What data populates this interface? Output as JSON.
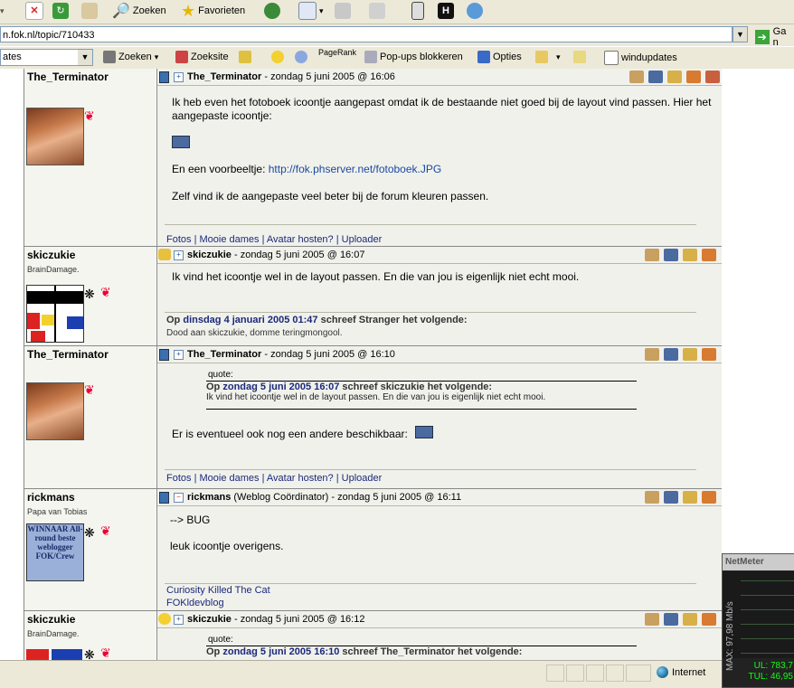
{
  "toolbar": {
    "search_label": "Zoeken",
    "favorites_label": "Favorieten"
  },
  "address": {
    "url": "n.fok.nl/topic/710433",
    "go_label": "Ga n"
  },
  "google_bar": {
    "dropdown_value": "ates",
    "search_label": "Zoeken",
    "site_label": "Zoeksite",
    "pagerank_label": "PageRank",
    "popups_label": "Pop-ups blokkeren",
    "options_label": "Opties",
    "windupdates_label": "windupdates"
  },
  "posts": [
    {
      "username": "The_Terminator",
      "header_user": "The_Terminator",
      "header_date": " - zondag 5 juni 2005 @ 16:06",
      "text1": "Ik heb even het fotoboek icoontje aangepast omdat ik de bestaande niet goed bij de layout vind passen. Hier het aangepaste icoontje:",
      "text2_prefix": "En een voorbeeltje: ",
      "text2_link": "http://fok.phserver.net/fotoboek.JPG",
      "text3": "Zelf vind ik de aangepaste veel beter bij de forum kleuren passen.",
      "signature": "Fotos | Mooie dames | Avatar hosten? | Uploader"
    },
    {
      "username": "skiczukie",
      "user_title": "BrainDamage.",
      "header_user": "skiczukie",
      "header_date": " - zondag 5 juni 2005 @ 16:07",
      "text1": "Ik vind het icoontje wel in de layout passen. En die van jou is eigenlijk niet echt mooi.",
      "sig_quote_prefix": "Op ",
      "sig_quote_date": "dinsdag 4 januari 2005 01:47",
      "sig_quote_suffix": " schreef Stranger het volgende:",
      "sig_quote_text": "Dood aan skiczukie, domme teringmongool."
    },
    {
      "username": "The_Terminator",
      "header_user": "The_Terminator",
      "header_date": " - zondag 5 juni 2005 @ 16:10",
      "quote_caption": "quote:",
      "quote_prefix": "Op ",
      "quote_date": "zondag 5 juni 2005 16:07",
      "quote_suffix": " schreef skiczukie het volgende:",
      "quote_text": "Ik vind het icoontje wel in de layout passen. En die van jou is eigenlijk niet echt mooi.",
      "text1": "Er is eventueel ook nog een andere beschikbaar:",
      "signature": "Fotos | Mooie dames | Avatar hosten? | Uploader"
    },
    {
      "username": "rickmans",
      "user_title": "Papa van Tobias",
      "avatar_text": "WINNAAR All-round beste weblogger FOK/Crew",
      "header_user": "rickmans",
      "header_role": " (Weblog Coördinator)",
      "header_date": " - zondag 5 juni 2005 @ 16:11",
      "text1": "--> BUG",
      "text2": "leuk icoontje overigens.",
      "sig1": "Curiosity Killed The Cat",
      "sig2": "FOKldevblog"
    },
    {
      "username": "skiczukie",
      "user_title": "BrainDamage.",
      "header_user": "skiczukie",
      "header_date": " - zondag 5 juni 2005 @ 16:12",
      "quote_caption": "quote:",
      "quote_prefix": "Op ",
      "quote_date": "zondag 5 juni 2005 16:10",
      "quote_suffix": " schreef The_Terminator het volgende:"
    }
  ],
  "netmeter": {
    "title": "NetMeter",
    "max_label": "MAX: 97,98 Mb/s",
    "ul": "UL: 783,7",
    "tul": "TUL: 46,95"
  },
  "status": {
    "zone": "Internet"
  },
  "colors": {
    "forum_bg": "#f1f1ec",
    "sidebar_bg": "#f5f5ef",
    "link": "#1a4aa0",
    "date_blue": "#1a2a7a"
  }
}
